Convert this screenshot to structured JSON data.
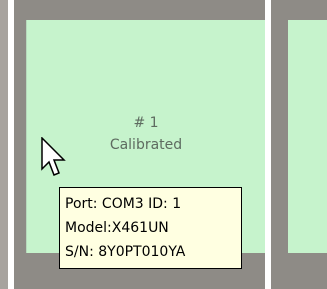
{
  "device_panels": [
    {
      "number": "# 1",
      "status": "Calibrated"
    }
  ],
  "tooltip": {
    "lines": [
      "Port: COM3 ID: 1",
      "Model:X461UN",
      "S/N: 8Y0PT010YA"
    ]
  },
  "colors": {
    "panel_fill": "#c6f3cc",
    "frame": "#8e8b86",
    "tooltip_bg": "#ffffe1",
    "panel_text": "#5e6b60"
  },
  "cursor_icon": "arrow-pointer-icon"
}
